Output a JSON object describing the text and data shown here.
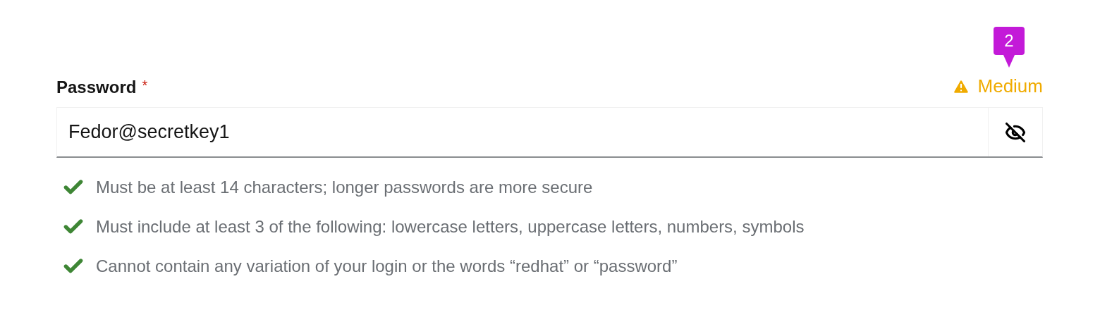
{
  "callout": {
    "number": "2"
  },
  "field": {
    "label": "Password",
    "required_mark": "*",
    "strength": {
      "kind": "medium",
      "text": "Medium"
    },
    "value": "Fedor@secretkey1",
    "password_visible": true
  },
  "requirements": [
    {
      "text": "Must be at least 14 characters; longer passwords are more secure",
      "met": true
    },
    {
      "text": "Must include at least 3 of the following: lowercase letters, uppercase letters, numbers, symbols",
      "met": true
    },
    {
      "text": "Cannot contain any variation of your login or the words “redhat” or “password”",
      "met": true
    }
  ]
}
